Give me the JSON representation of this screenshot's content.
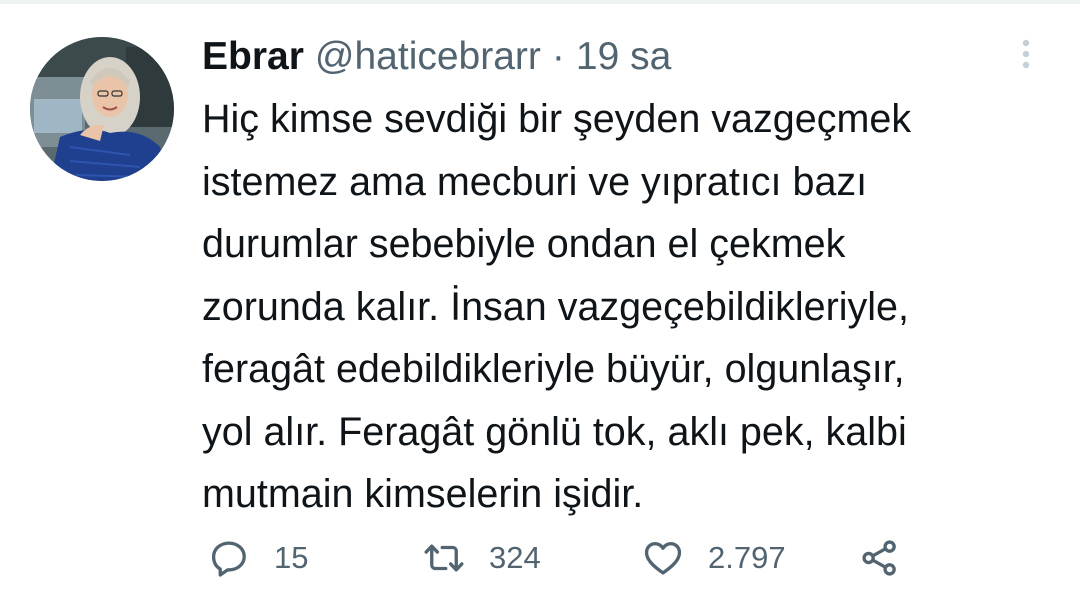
{
  "tweet": {
    "author": {
      "display_name": "Ebrar",
      "handle": "@haticebrarr",
      "separator": "·",
      "time": "19 sa"
    },
    "text": "Hiç kimse sevdiği bir şeyden vazgeçmek\nistemez ama mecburi ve yıpratıcı bazı\ndurumlar sebebiyle ondan el çekmek\nzorunda kalır. İnsan vazgeçebildikleriyle,\nferagât edebildikleriyle büyür, olgunlaşır,\nyol alır. Feragât gönlü tok, aklı pek, kalbi\nmutmain kimselerin işidir.",
    "actions": {
      "replies": "15",
      "retweets": "324",
      "likes": "2.797"
    }
  },
  "icons": {
    "more": "more-vertical-icon",
    "reply": "reply-icon",
    "retweet": "retweet-icon",
    "like": "heart-icon",
    "share": "share-icon"
  },
  "colors": {
    "text_primary": "#0f1419",
    "text_secondary": "#536471",
    "divider": "#eff3f4"
  }
}
